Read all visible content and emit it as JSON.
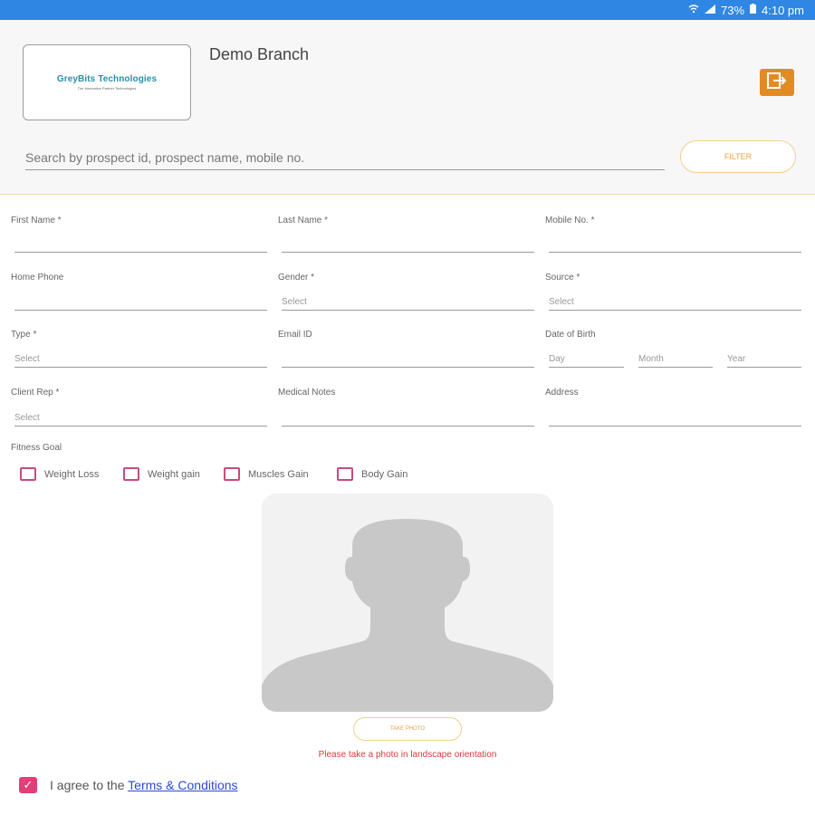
{
  "status_bar": {
    "battery": "73%",
    "time": "4:10 pm",
    "icons": [
      "wifi-icon",
      "signal-icon",
      "battery-icon"
    ]
  },
  "header": {
    "logo_title": "GreyBits Technologies",
    "logo_tagline": "The Innovative Partner Technologies",
    "branch_name": "Demo Branch",
    "logout_icon": "logout-icon",
    "search_placeholder": "Search by prospect id, prospect name, mobile no.",
    "filter_label": "FILTER"
  },
  "form": {
    "first_name": {
      "label": "First Name *",
      "value": ""
    },
    "last_name": {
      "label": "Last Name *",
      "value": ""
    },
    "mobile": {
      "label": "Mobile No. *",
      "value": ""
    },
    "home_phone": {
      "label": "Home Phone",
      "value": ""
    },
    "gender": {
      "label": "Gender *",
      "value": "Select"
    },
    "source": {
      "label": "Source *",
      "value": "Select"
    },
    "type": {
      "label": "Type *",
      "value": "Select"
    },
    "email": {
      "label": "Email ID",
      "value": ""
    },
    "dob": {
      "label": "Date of Birth",
      "day": "Day",
      "month": "Month",
      "year": "Year"
    },
    "client_rep": {
      "label": "Client Rep *",
      "value": "Select"
    },
    "medical_notes": {
      "label": "Medical Notes",
      "value": ""
    },
    "address": {
      "label": "Address",
      "value": ""
    },
    "fitness_goal": {
      "label": "Fitness Goal",
      "options": [
        "Weight Loss",
        "Weight gain",
        "Muscles Gain",
        "Body Gain"
      ]
    }
  },
  "photo": {
    "take_photo_label": "TAKE PHOTO",
    "hint": "Please take a photo in landscape orientation"
  },
  "agreement": {
    "checked": true,
    "text": "I agree to the",
    "link_text": "Terms & Conditions"
  },
  "colors": {
    "status_bar": "#2f86e3",
    "accent_orange": "#e38b23",
    "checkbox_pink": "#c94a7e",
    "hint_red": "#e0383e",
    "link_blue": "#2a49d6"
  }
}
